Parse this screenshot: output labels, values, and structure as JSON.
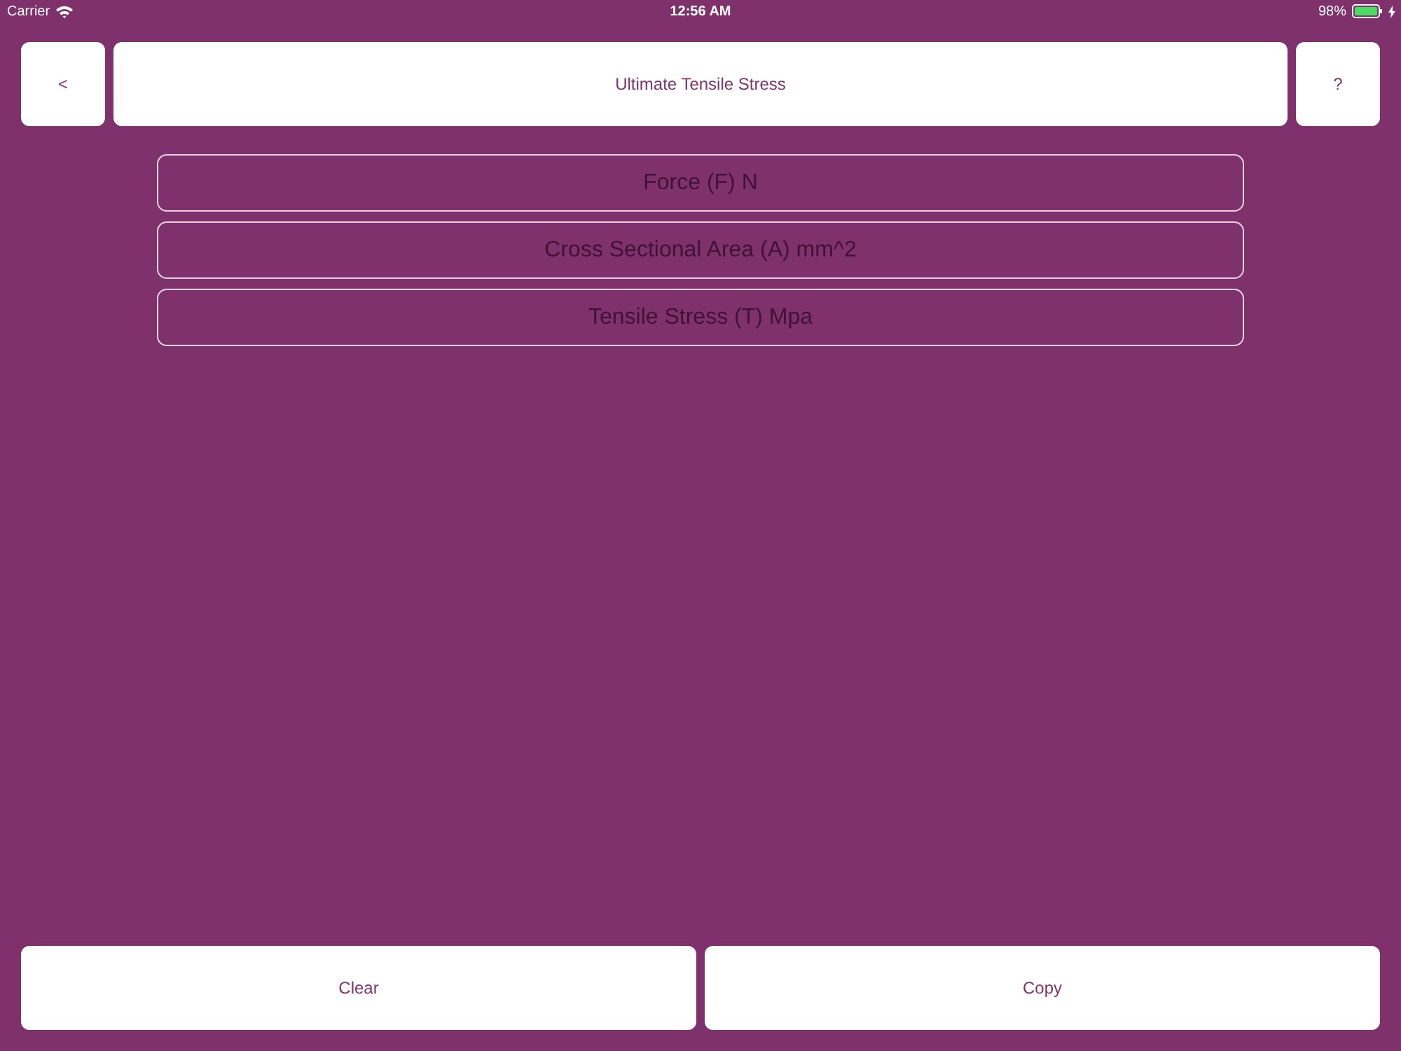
{
  "status_bar": {
    "carrier": "Carrier",
    "time": "12:56 AM",
    "battery": "98%"
  },
  "header": {
    "back": "<",
    "title": "Ultimate Tensile Stress",
    "help": "?"
  },
  "fields": [
    {
      "placeholder": "Force (F) N"
    },
    {
      "placeholder": "Cross Sectional Area (A) mm^2"
    },
    {
      "placeholder": "Tensile Stress (T) Mpa"
    }
  ],
  "buttons": [
    "Clear",
    "Copy"
  ]
}
